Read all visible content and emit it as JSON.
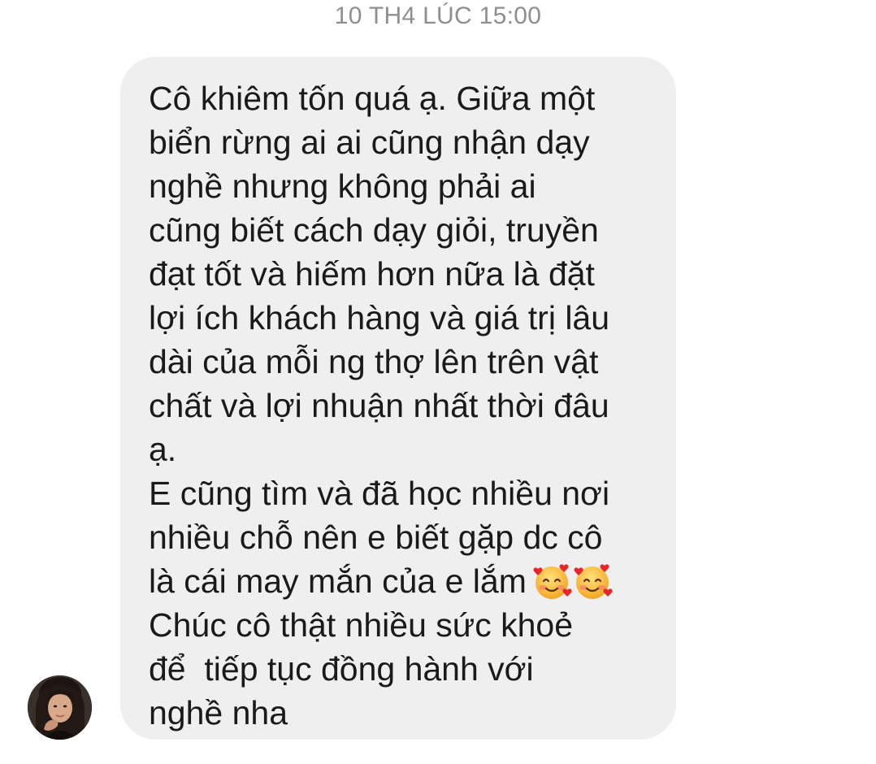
{
  "conversation": {
    "timestamp": "10 TH4 LÚC 15:00"
  },
  "message": {
    "lines": [
      "Cô khiêm tốn quá ạ. Giữa một",
      "biển rừng ai ai cũng nhận dạy",
      "nghề nhưng không phải ai",
      "cũng biết cách dạy giỏi, truyền",
      "đạt tốt và hiếm hơn nữa là đặt",
      "lợi ích khách hàng và giá trị lâu",
      "dài của mỗi ng thợ lên trên vật",
      "chất và lợi nhuận nhất thời đâu",
      "ạ.",
      "E cũng tìm và đã học nhiều nơi",
      "nhiều chỗ nên e biết gặp dc cô",
      "là cái may mắn của e lắm",
      "Chúc cô thật nhiều sức khoẻ",
      "để  tiếp tục đồng hành với",
      "nghề nha"
    ],
    "emojis": [
      "smiling-face-with-hearts-icon",
      "smiling-face-with-hearts-icon"
    ]
  },
  "sender": {
    "avatar_icon": "user-avatar-photo"
  },
  "colors": {
    "bubble": "#efefef",
    "text": "#1a1a1a",
    "timestamp": "#8e8e93"
  }
}
